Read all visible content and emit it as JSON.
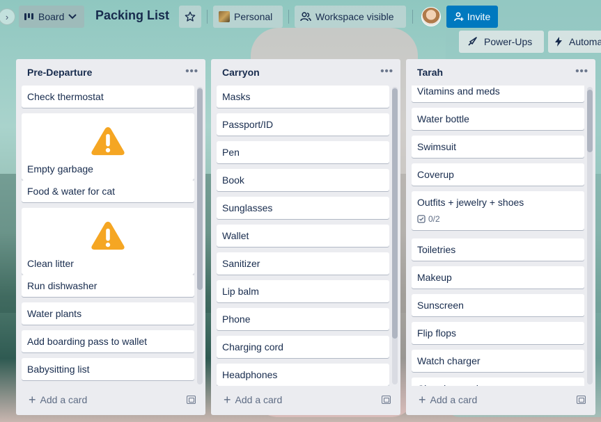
{
  "header": {
    "view_label": "Board",
    "board_title": "Packing List",
    "workspace_label": "Personal",
    "visibility_label": "Workspace visible",
    "invite_label": "Invite",
    "powerups_label": "Power-Ups",
    "automation_label": "Automa"
  },
  "lists": [
    {
      "name": "Pre-Departure",
      "add_card_label": "Add a card",
      "cards": [
        {
          "title": "Check thermostat"
        },
        {
          "title": "Empty garbage",
          "cover": "warning"
        },
        {
          "title": "Food & water for cat"
        },
        {
          "title": "Clean litter",
          "cover": "warning"
        },
        {
          "title": "Run dishwasher"
        },
        {
          "title": "Water plants"
        },
        {
          "title": "Add boarding pass to wallet"
        },
        {
          "title": "Babysitting list"
        }
      ]
    },
    {
      "name": "Carryon",
      "add_card_label": "Add a card",
      "cards": [
        {
          "title": "Masks"
        },
        {
          "title": "Passport/ID"
        },
        {
          "title": "Pen"
        },
        {
          "title": "Book"
        },
        {
          "title": "Sunglasses"
        },
        {
          "title": "Wallet"
        },
        {
          "title": "Sanitizer"
        },
        {
          "title": "Lip balm"
        },
        {
          "title": "Phone"
        },
        {
          "title": "Charging cord"
        },
        {
          "title": "Headphones"
        }
      ]
    },
    {
      "name": "Tarah",
      "add_card_label": "Add a card",
      "cards": [
        {
          "title": "Vitamins and meds"
        },
        {
          "title": "Water bottle"
        },
        {
          "title": "Swimsuit"
        },
        {
          "title": "Coverup"
        },
        {
          "title": "Outfits + jewelry + shoes",
          "checklist": "0/2"
        },
        {
          "title": "Toiletries"
        },
        {
          "title": "Makeup"
        },
        {
          "title": "Sunscreen"
        },
        {
          "title": "Flip flops"
        },
        {
          "title": "Watch charger"
        },
        {
          "title": "Charging cords"
        }
      ]
    }
  ],
  "colors": {
    "invite_bg": "#0079bf",
    "list_bg": "#ebecf0",
    "text": "#172b4d",
    "warning": "#f5a623"
  },
  "icons": [
    "chevron-right-icon",
    "board-icon",
    "chevron-down-icon",
    "star-icon",
    "people-icon",
    "person-add-icon",
    "rocket-icon",
    "bolt-icon",
    "more-icon",
    "plus-icon",
    "template-icon",
    "checklist-icon",
    "warning-icon"
  ]
}
